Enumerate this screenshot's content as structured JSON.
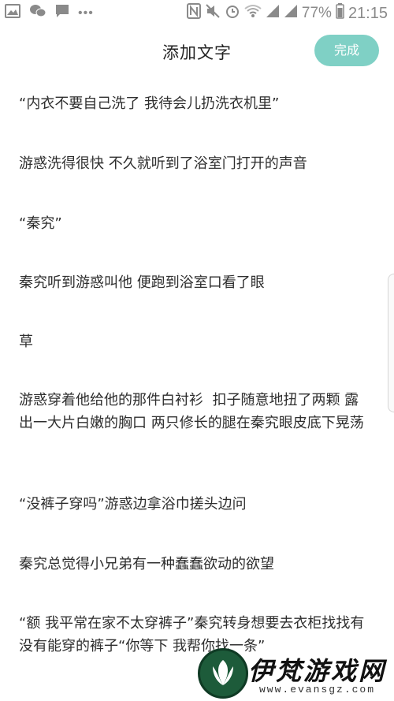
{
  "status_bar": {
    "battery_percent": "77%",
    "time": "21:15",
    "dots": "•••"
  },
  "header": {
    "title": "添加文字",
    "done_label": "完成"
  },
  "content": {
    "paragraphs": [
      "“内衣不要自己洗了 我待会儿扔洗衣机里”",
      "游惑洗得很快 不久就听到了浴室门打开的声音",
      "“秦究”",
      "秦究听到游惑叫他 便跑到浴室口看了眼",
      "草",
      "游惑穿着他给他的那件白衬衫  扣子随意地扭了两颗 露出一大片白嫩的胸口 两只修长的腿在秦究眼皮底下晃荡",
      "“没裤子穿吗”游惑边拿浴巾搓头边问",
      "秦究总觉得小兄弟有一种蠢蠢欲动的欲望",
      "“额 我平常在家不太穿裤子”秦究转身想要去衣柜找找有没有能穿的裤子“你等下 我帮你找一条”"
    ]
  },
  "watermark": {
    "name": "伊梵游戏网",
    "url": "www.evansgz.com"
  },
  "colors": {
    "accent": "#7fd0c5",
    "text": "#2e2e2e",
    "status_icons": "#8a8a8a"
  }
}
